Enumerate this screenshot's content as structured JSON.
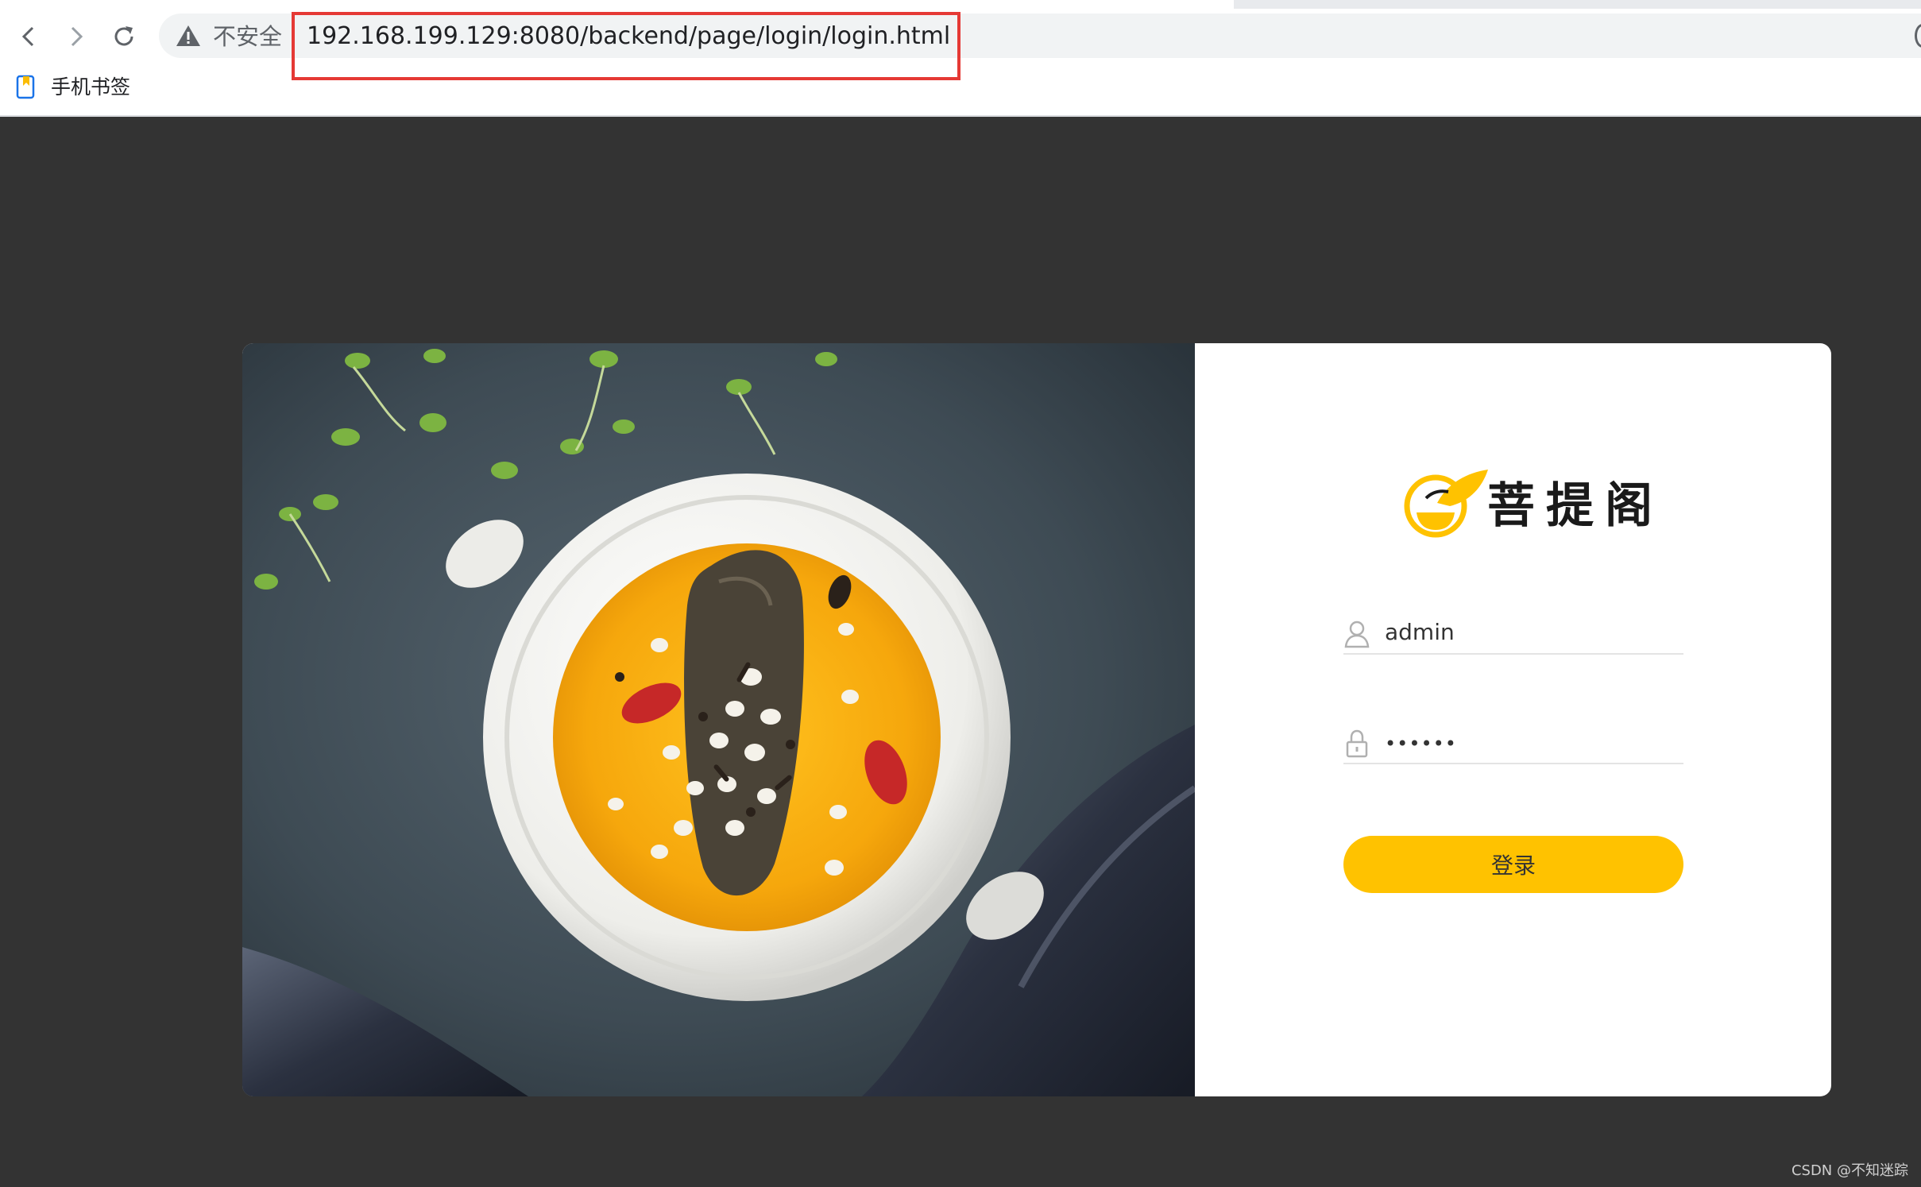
{
  "browser": {
    "security_label": "不安全",
    "url": "192.168.199.129:8080/backend/page/login/login.html",
    "bookmarks": [
      {
        "label": "手机书签"
      }
    ]
  },
  "login": {
    "brand_name": "菩提阁",
    "username": {
      "value": "admin"
    },
    "password": {
      "value": "••••••"
    },
    "submit_label": "登录"
  },
  "colors": {
    "page_background": "#333333",
    "accent": "#ffc200",
    "url_highlight": "#e53935"
  },
  "footer": {
    "watermark": "CSDN @不知迷踪"
  }
}
